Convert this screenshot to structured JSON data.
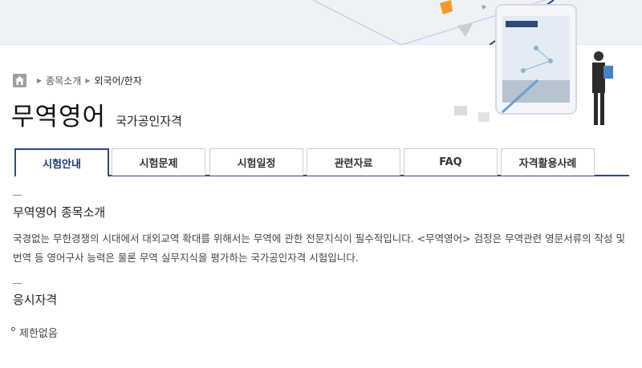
{
  "breadcrumb": {
    "home_icon": "home-icon",
    "items": [
      "종목소개",
      "외국어/한자"
    ]
  },
  "header": {
    "title": "무역영어",
    "subtitle": "국가공인자격"
  },
  "tabs": [
    {
      "label": "시험안내",
      "active": true
    },
    {
      "label": "시험문제",
      "active": false
    },
    {
      "label": "시험일정",
      "active": false
    },
    {
      "label": "관련자료",
      "active": false
    },
    {
      "label": "FAQ",
      "active": false
    },
    {
      "label": "자격활용사례",
      "active": false
    }
  ],
  "sections": {
    "intro": {
      "title": "무역영어 종목소개",
      "text": "국경없는 무한경쟁의 시대에서 대외교역 확대를 위해서는 무역에 관한 전문지식이 필수적입니다. <무역영어> 검정은 무역관련 영문서류의 작성 및 번역 등 영어구사 능력은 물론 무역 실무지식을 평가하는 국가공인자격 시험입니다."
    },
    "eligibility": {
      "title": "응시자격",
      "items": [
        "제한없음"
      ]
    }
  },
  "colors": {
    "accent": "#2e4a78",
    "top_band": "#eef1f5",
    "text": "#444444"
  }
}
